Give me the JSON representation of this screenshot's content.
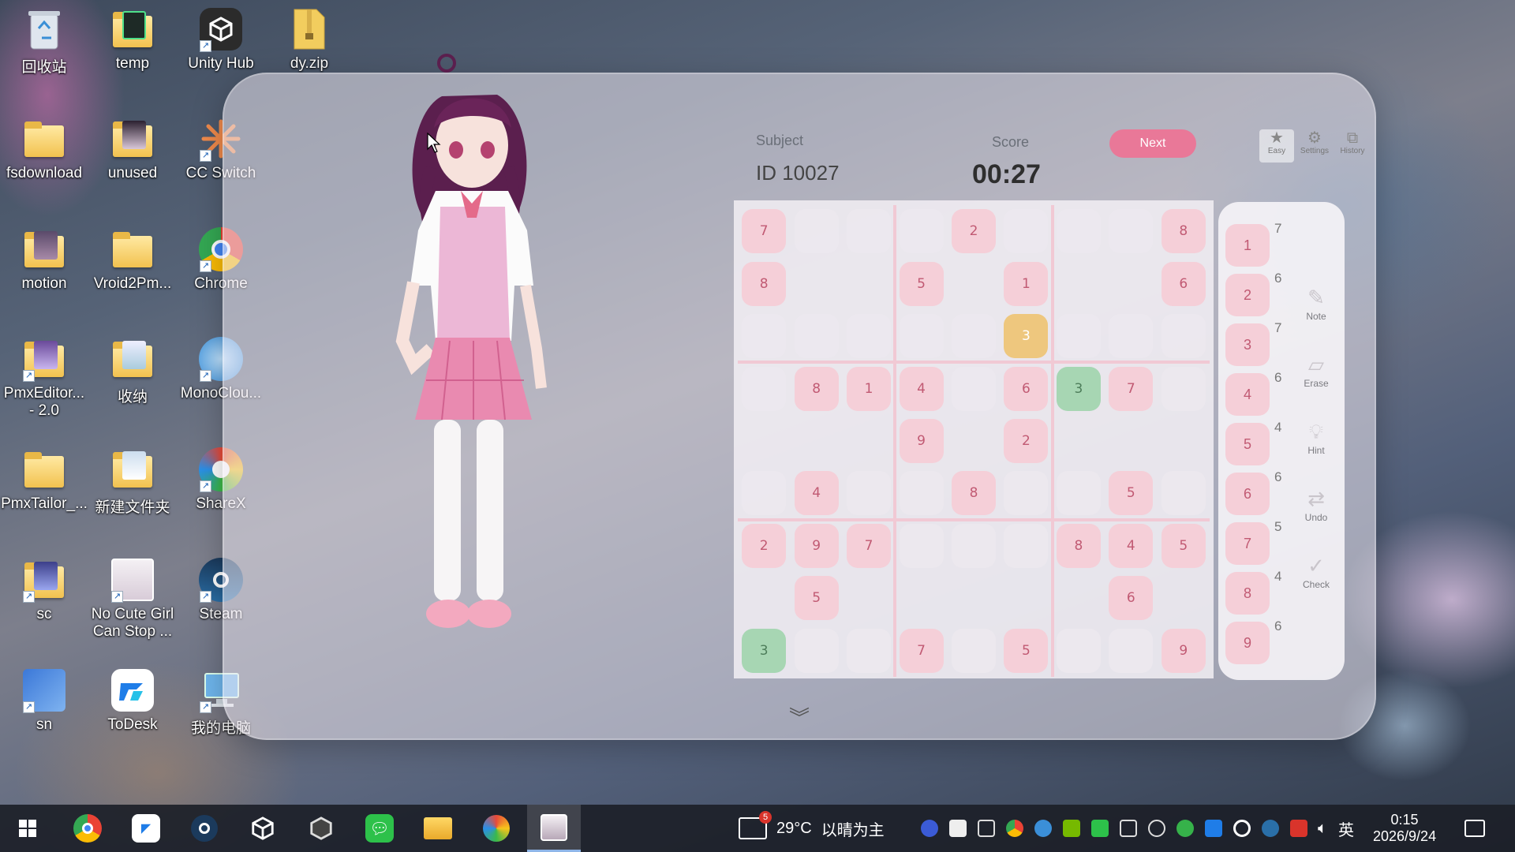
{
  "desktop": {
    "icons": [
      {
        "label": "回收站"
      },
      {
        "label": "temp"
      },
      {
        "label": "Unity Hub"
      },
      {
        "label": "dy.zip"
      },
      {
        "label": "fsdownload"
      },
      {
        "label": "unused"
      },
      {
        "label": "CC Switch"
      },
      {
        "label": "motion"
      },
      {
        "label": "Vroid2Pm..."
      },
      {
        "label": "Chrome"
      },
      {
        "label": "PmxEditor... - 2.0"
      },
      {
        "label": "收纳"
      },
      {
        "label": "MonoClou..."
      },
      {
        "label": "PmxTailor_..."
      },
      {
        "label": "新建文件夹"
      },
      {
        "label": "ShareX"
      },
      {
        "label": "sc"
      },
      {
        "label": "No Cute Girl Can Stop ..."
      },
      {
        "label": "Steam"
      },
      {
        "label": "sn"
      },
      {
        "label": "ToDesk"
      },
      {
        "label": "我的电脑"
      }
    ]
  },
  "game": {
    "subject_label": "Subject",
    "subject_id": "ID 10027",
    "score_label": "Score",
    "timer": "00:27",
    "next_label": "Next",
    "top_buttons": [
      {
        "label": "Easy",
        "icon": "star-icon"
      },
      {
        "label": "Settings",
        "icon": "gear-icon"
      },
      {
        "label": "History",
        "icon": "history-icon"
      }
    ],
    "board": [
      [
        "7",
        "",
        "",
        "",
        "2",
        "",
        "",
        "",
        "8"
      ],
      [
        "8",
        "",
        "",
        "5",
        "",
        "1",
        "",
        "",
        "6"
      ],
      [
        "",
        "",
        "",
        "",
        "",
        "3",
        "",
        "",
        ""
      ],
      [
        "",
        "8",
        "1",
        "4",
        "",
        "6",
        "3",
        "7",
        ""
      ],
      [
        "",
        "",
        "",
        "9",
        "",
        "2",
        "",
        "",
        ""
      ],
      [
        "",
        "4",
        "",
        "",
        "8",
        "",
        "",
        "5",
        ""
      ],
      [
        "2",
        "9",
        "7",
        "",
        "",
        "",
        "8",
        "4",
        "5"
      ],
      [
        "",
        "5",
        "",
        "",
        "",
        "",
        "",
        "6",
        ""
      ],
      [
        "3",
        "",
        "",
        "7",
        "",
        "5",
        "",
        "",
        "9"
      ]
    ],
    "numpad": [
      {
        "num": "1",
        "count": "7"
      },
      {
        "num": "2",
        "count": "6"
      },
      {
        "num": "3",
        "count": "7"
      },
      {
        "num": "4",
        "count": "6"
      },
      {
        "num": "5",
        "count": "4"
      },
      {
        "num": "6",
        "count": "6"
      },
      {
        "num": "7",
        "count": "5"
      },
      {
        "num": "8",
        "count": "4"
      },
      {
        "num": "9",
        "count": "6"
      }
    ],
    "tools": [
      {
        "label": "Note",
        "icon": "note-icon"
      },
      {
        "label": "Erase",
        "icon": "eraser-icon"
      },
      {
        "label": "Hint",
        "icon": "lightbulb-icon"
      },
      {
        "label": "Undo",
        "icon": "undo-icon"
      },
      {
        "label": "Check",
        "icon": "check-icon"
      }
    ]
  },
  "taskbar": {
    "weather_badge": "5",
    "weather_temp": "29°C",
    "weather_desc": "以晴为主",
    "ime": "英",
    "time": "0:15",
    "date": "2026/9/24"
  }
}
